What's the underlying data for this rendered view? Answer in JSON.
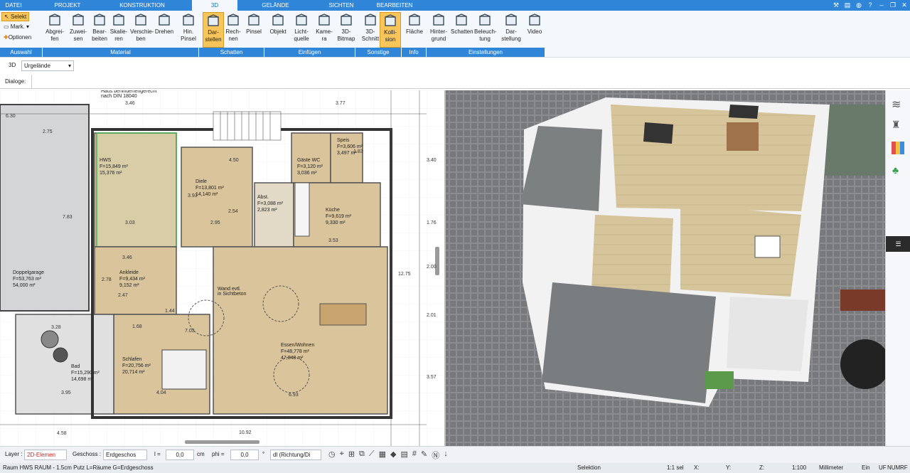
{
  "tabs": [
    "DATEI",
    "PROJEKT",
    "KONSTRUKTION",
    "3D",
    "GELÄNDE",
    "SICHTEN",
    "BEARBEITEN"
  ],
  "quick": {
    "select": "Selekt",
    "mark": "Mark.",
    "options": "Optionen"
  },
  "ribbon": {
    "buttons": [
      {
        "l1": "Abgrei-",
        "l2": "fen"
      },
      {
        "l1": "Zuwei-",
        "l2": "sen"
      },
      {
        "l1": "Bear-",
        "l2": "beiten"
      },
      {
        "l1": "Skalie-",
        "l2": "ren"
      },
      {
        "l1": "Verschie-",
        "l2": "ben"
      },
      {
        "l1": "Drehen",
        "l2": ""
      },
      {
        "l1": "Hin.",
        "l2": "Pinsel"
      },
      {
        "l1": "Dar-",
        "l2": "stellen"
      },
      {
        "l1": "Rech-",
        "l2": "nen"
      },
      {
        "l1": "Pinsel",
        "l2": ""
      },
      {
        "l1": "Objekt",
        "l2": ""
      },
      {
        "l1": "Licht-",
        "l2": "quelle"
      },
      {
        "l1": "Kame-",
        "l2": "ra"
      },
      {
        "l1": "3D-",
        "l2": "Bitmap"
      },
      {
        "l1": "3D-",
        "l2": "Schnitt"
      },
      {
        "l1": "Kolli-",
        "l2": "sion"
      },
      {
        "l1": "Fläche",
        "l2": ""
      },
      {
        "l1": "Hinter-",
        "l2": "grund"
      },
      {
        "l1": "Schatten",
        "l2": ""
      },
      {
        "l1": "Beleuch-",
        "l2": "tung"
      },
      {
        "l1": "Dar-",
        "l2": "stellung"
      },
      {
        "l1": "Video",
        "l2": ""
      }
    ],
    "groups": [
      "Auswahl",
      "Material",
      "Schatten",
      "Einfügen",
      "Sonstige",
      "Info",
      "Einstellungen"
    ]
  },
  "toolrow": {
    "mode": "3D",
    "terrain": "Urgelände"
  },
  "dialog_label": "Dialoge:",
  "plan": {
    "rooms": [
      {
        "name": "HWS",
        "f": "F=15,849 m²",
        "a": "15,376 m²"
      },
      {
        "name": "Diele",
        "f": "F=13,801 m²",
        "a": "14,140 m²"
      },
      {
        "name": "Küche",
        "f": "F=9,619 m²",
        "a": "9,330 m²"
      },
      {
        "name": "Ankleide",
        "f": "F=9,434 m²",
        "a": "9,152 m²"
      },
      {
        "name": "Doppelgarage",
        "f": "F=53,763 m²",
        "a": "54,000 m²"
      },
      {
        "name": "Schlafen",
        "f": "F=20,756 m²",
        "a": "20,714 m²"
      },
      {
        "name": "Bad",
        "f": "F=15,290 m²",
        "a": "14,698 m²"
      },
      {
        "name": "Essen/Wohnen",
        "f": "F=48,778 m²",
        "a": "47,848 m²"
      },
      {
        "name": "Speis",
        "f": "F=3,606 m²",
        "a": "3,497 m²"
      },
      {
        "name": "Gäste WC",
        "f": "F=3,120 m²",
        "a": "3,036 m²"
      },
      {
        "name": "Abst.",
        "f": "F=3,088 m²",
        "a": "2,823 m²"
      }
    ],
    "dims": [
      "6.30",
      "2.75",
      "3.46",
      "3.77",
      "4.50",
      "3.03",
      "2.95",
      "3.53",
      "3.46",
      "2.78",
      "2.47",
      "1.44",
      "4.04",
      "6.93",
      "10.92",
      "4.58",
      "3.95",
      "3.28",
      "7.83",
      "1.83",
      "3.40",
      "1.76",
      "2.00",
      "2.01",
      "3.57",
      "12.75",
      "3.93",
      "7.03",
      "1.68",
      "2.54"
    ],
    "notes": [
      "Haus behindertengerecht",
      "nach DIN 18040",
      "Wand evtl.",
      "in Sichtbeton"
    ]
  },
  "status": {
    "layer_label": "Layer :",
    "layer": "2D-Elemen",
    "floor_label": "Geschoss :",
    "floor": "Erdgeschos",
    "l_label": "l =",
    "l_val": "0,0",
    "cm": "cm",
    "phi_label": "phi =",
    "phi_val": "0,0",
    "deg": "°",
    "dir": "dl (Richtung/Di"
  },
  "statusline": {
    "text": "Raum HWS RAUM - 1.5cm Putz L=Räume G=Erdgeschoss",
    "mode": "Selektion",
    "scale1": "1:1 sel",
    "x": "X:",
    "y": "Y:",
    "z": "Z:",
    "scale2": "1:100",
    "unit": "Millimeter",
    "ein": "Ein",
    "uf": "UF",
    "num": "NUM",
    "rf": "RF"
  },
  "colors": {
    "accent": "#2f86d9",
    "selected": "#f7c55a",
    "floor": "#d9c49b"
  }
}
